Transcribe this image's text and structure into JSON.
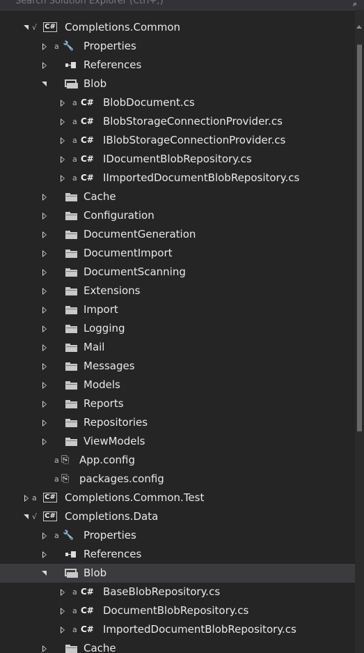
{
  "search": {
    "text": "Search Solution Explorer (Ctrl+;)",
    "icon": "search-icon"
  },
  "tree": [
    {
      "level": 0,
      "arrow": "expanded",
      "marker": "check",
      "icon": "csproj-icon",
      "label": "Completions.Common"
    },
    {
      "level": 1,
      "arrow": "collapsed",
      "marker": "lock",
      "icon": "wrench-icon",
      "label": "Properties"
    },
    {
      "level": 1,
      "arrow": "collapsed",
      "marker": "",
      "icon": "references-icon",
      "label": "References"
    },
    {
      "level": 1,
      "arrow": "expanded",
      "marker": "",
      "icon": "folder-open-icon",
      "label": "Blob"
    },
    {
      "level": 2,
      "arrow": "collapsed",
      "marker": "lock",
      "icon": "csharp-file-icon",
      "label": "BlobDocument.cs"
    },
    {
      "level": 2,
      "arrow": "collapsed",
      "marker": "lock",
      "icon": "csharp-file-icon",
      "label": "BlobStorageConnectionProvider.cs"
    },
    {
      "level": 2,
      "arrow": "collapsed",
      "marker": "lock",
      "icon": "csharp-file-icon",
      "label": "IBlobStorageConnectionProvider.cs"
    },
    {
      "level": 2,
      "arrow": "collapsed",
      "marker": "lock",
      "icon": "csharp-file-icon",
      "label": "IDocumentBlobRepository.cs"
    },
    {
      "level": 2,
      "arrow": "collapsed",
      "marker": "lock",
      "icon": "csharp-file-icon",
      "label": "IImportedDocumentBlobRepository.cs"
    },
    {
      "level": 1,
      "arrow": "collapsed",
      "marker": "",
      "icon": "folder-icon",
      "label": "Cache"
    },
    {
      "level": 1,
      "arrow": "collapsed",
      "marker": "",
      "icon": "folder-icon",
      "label": "Configuration"
    },
    {
      "level": 1,
      "arrow": "collapsed",
      "marker": "",
      "icon": "folder-icon",
      "label": "DocumentGeneration"
    },
    {
      "level": 1,
      "arrow": "collapsed",
      "marker": "",
      "icon": "folder-icon",
      "label": "DocumentImport"
    },
    {
      "level": 1,
      "arrow": "collapsed",
      "marker": "",
      "icon": "folder-icon",
      "label": "DocumentScanning"
    },
    {
      "level": 1,
      "arrow": "collapsed",
      "marker": "",
      "icon": "folder-icon",
      "label": "Extensions"
    },
    {
      "level": 1,
      "arrow": "collapsed",
      "marker": "",
      "icon": "folder-icon",
      "label": "Import"
    },
    {
      "level": 1,
      "arrow": "collapsed",
      "marker": "",
      "icon": "folder-icon",
      "label": "Logging"
    },
    {
      "level": 1,
      "arrow": "collapsed",
      "marker": "",
      "icon": "folder-icon",
      "label": "Mail"
    },
    {
      "level": 1,
      "arrow": "collapsed",
      "marker": "",
      "icon": "folder-icon",
      "label": "Messages"
    },
    {
      "level": 1,
      "arrow": "collapsed",
      "marker": "",
      "icon": "folder-icon",
      "label": "Models"
    },
    {
      "level": 1,
      "arrow": "collapsed",
      "marker": "",
      "icon": "folder-icon",
      "label": "Reports"
    },
    {
      "level": 1,
      "arrow": "collapsed",
      "marker": "",
      "icon": "folder-icon",
      "label": "Repositories"
    },
    {
      "level": 1,
      "arrow": "collapsed",
      "marker": "",
      "icon": "folder-icon",
      "label": "ViewModels"
    },
    {
      "level": 1,
      "arrow": "none",
      "marker": "lock",
      "icon": "config-file-icon",
      "label": "App.config"
    },
    {
      "level": 1,
      "arrow": "none",
      "marker": "lock",
      "icon": "config-file-icon",
      "label": "packages.config"
    },
    {
      "level": 0,
      "arrow": "collapsed",
      "marker": "lock",
      "icon": "csproj-icon",
      "label": "Completions.Common.Test"
    },
    {
      "level": 0,
      "arrow": "expanded",
      "marker": "check",
      "icon": "csproj-icon",
      "label": "Completions.Data"
    },
    {
      "level": 1,
      "arrow": "collapsed",
      "marker": "lock",
      "icon": "wrench-icon",
      "label": "Properties"
    },
    {
      "level": 1,
      "arrow": "collapsed",
      "marker": "",
      "icon": "references-icon",
      "label": "References"
    },
    {
      "level": 1,
      "arrow": "expanded",
      "marker": "",
      "icon": "folder-open-icon",
      "label": "Blob",
      "selected": true
    },
    {
      "level": 2,
      "arrow": "collapsed",
      "marker": "lock",
      "icon": "csharp-file-icon",
      "label": "BaseBlobRepository.cs"
    },
    {
      "level": 2,
      "arrow": "collapsed",
      "marker": "lock",
      "icon": "csharp-file-icon",
      "label": "DocumentBlobRepository.cs"
    },
    {
      "level": 2,
      "arrow": "collapsed",
      "marker": "lock",
      "icon": "csharp-file-icon",
      "label": "ImportedDocumentBlobRepository.cs"
    },
    {
      "level": 1,
      "arrow": "collapsed",
      "marker": "",
      "icon": "folder-icon",
      "label": "Cache"
    }
  ],
  "csharp_glyph": "C#",
  "csproj_glyph": "C#",
  "lock_glyph": "a",
  "check_glyph": "√"
}
